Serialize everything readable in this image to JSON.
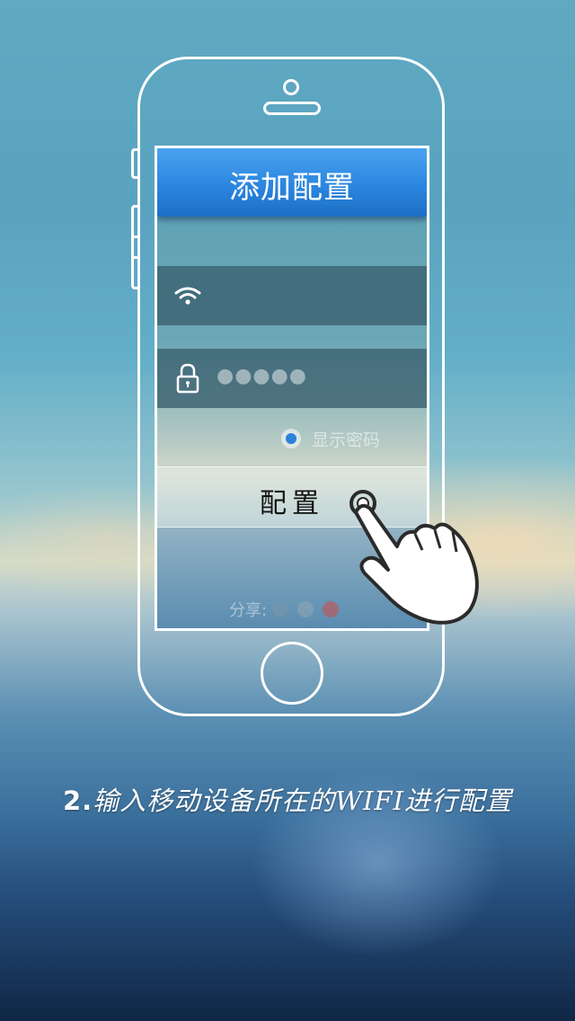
{
  "screen": {
    "nav_title": "添加配置",
    "wifi_field": {
      "icon": "wifi-icon",
      "value": ""
    },
    "password_field": {
      "icon": "lock-icon",
      "value": "●●●●●"
    },
    "show_password": {
      "label": "显示密码",
      "checked": true
    },
    "config_button": {
      "label": "配置"
    },
    "share": {
      "label": "分享:"
    }
  },
  "caption": {
    "number": "2.",
    "text": "输入移动设备所在的WIFI进行配置"
  },
  "colors": {
    "accent": "#2b86e0",
    "radio": "#2a82db"
  }
}
